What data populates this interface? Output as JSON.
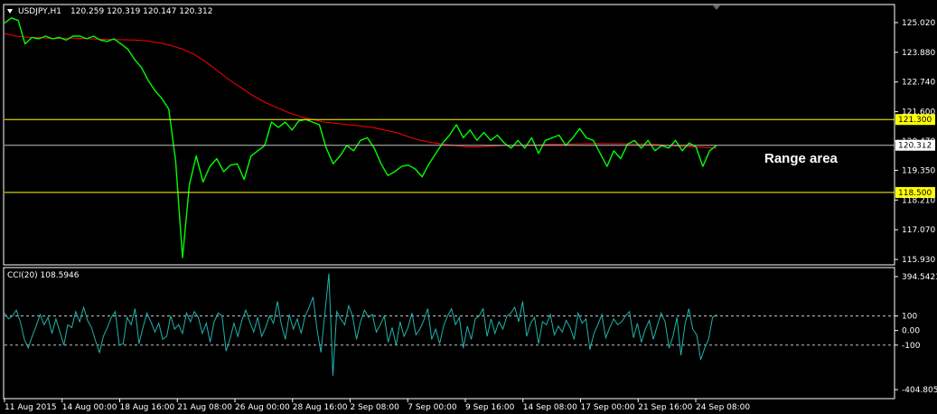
{
  "colors": {
    "background": "#000000",
    "frame": "#ffffff",
    "price": "#00ff00",
    "moving_average": "#ff0000",
    "level": "#ffff00",
    "level_tag": "#ffff00",
    "current_line": "#c0c0c0",
    "cci": "#20b2aa",
    "cci_level": "#c0c0c0"
  },
  "header": {
    "symbol": "USDJPY,H1",
    "ohlc": "120.259 120.319 120.147 120.312"
  },
  "annotation": "Range area",
  "chart_data": [
    {
      "type": "line",
      "panel": "price",
      "series": [
        {
          "values": [
            125.0,
            125.2,
            125.1,
            124.2,
            124.45,
            124.4,
            124.5,
            124.4,
            124.45,
            124.35,
            124.5,
            124.5,
            124.4,
            124.5,
            124.35,
            124.3,
            124.4,
            124.2,
            124.0,
            123.6,
            123.3,
            122.8,
            122.4,
            122.1,
            121.7,
            119.7,
            116.0,
            118.8,
            119.9,
            118.9,
            119.5,
            119.8,
            119.3,
            119.55,
            119.6,
            119.0,
            119.9,
            120.1,
            120.3,
            121.2,
            121.0,
            121.2,
            120.9,
            121.25,
            121.3,
            121.2,
            121.1,
            120.2,
            119.6,
            119.9,
            120.3,
            120.1,
            120.5,
            120.6,
            120.2,
            119.6,
            119.15,
            119.3,
            119.5,
            119.55,
            119.4,
            119.1,
            119.6,
            120.0,
            120.4,
            120.7,
            121.1,
            120.6,
            120.9,
            120.5,
            120.8,
            120.5,
            120.7,
            120.4,
            120.2,
            120.5,
            120.2,
            120.6,
            120.0,
            120.5,
            120.6,
            120.7,
            120.3,
            120.6,
            120.95,
            120.6,
            120.5,
            120.0,
            119.5,
            120.1,
            119.8,
            120.35,
            120.5,
            120.2,
            120.5,
            120.1,
            120.3,
            120.2,
            120.5,
            120.1,
            120.4,
            120.25,
            119.5,
            120.1,
            120.31
          ]
        },
        {
          "values": [
            124.6,
            124.5,
            124.45,
            124.45,
            124.4,
            124.42,
            124.42,
            124.4,
            124.38,
            124.37,
            124.36,
            124.35,
            124.32,
            124.25,
            124.15,
            124.0,
            123.8,
            123.5,
            123.15,
            122.8,
            122.5,
            122.2,
            121.95,
            121.75,
            121.55,
            121.4,
            121.3,
            121.2,
            121.15,
            121.1,
            121.05,
            121.0,
            120.9,
            120.8,
            120.65,
            120.5,
            120.42,
            120.35,
            120.3,
            120.25,
            120.25,
            120.28,
            120.3,
            120.3,
            120.32,
            120.33,
            120.35,
            120.35,
            120.36,
            120.37,
            120.38,
            120.37,
            120.37,
            120.36,
            120.36,
            120.34,
            120.3,
            120.27,
            120.25,
            120.23,
            120.2
          ]
        }
      ],
      "ylim": [
        115.93,
        125.02
      ],
      "y_ticks": [
        "125.020",
        "123.880",
        "122.740",
        "121.600",
        "120.470",
        "119.350",
        "118.210",
        "117.070",
        "115.930"
      ],
      "levels": [
        {
          "value": 121.3,
          "label": "121.300"
        },
        {
          "value": 118.5,
          "label": "118.500"
        }
      ],
      "current": {
        "value": 120.312,
        "label": "120.312"
      }
    },
    {
      "type": "line",
      "panel": "indicator",
      "title": "CCI(20) 108.5946",
      "series": [
        {
          "values": [
            120,
            80,
            100,
            140,
            60,
            -60,
            -120,
            -40,
            30,
            110,
            40,
            90,
            -20,
            80,
            -10,
            -100,
            40,
            20,
            130,
            60,
            160,
            70,
            20,
            -70,
            -150,
            -40,
            20,
            90,
            130,
            -100,
            -90,
            90,
            40,
            150,
            -90,
            20,
            120,
            60,
            -10,
            50,
            -60,
            -40,
            100,
            10,
            40,
            -20,
            120,
            60,
            130,
            90,
            -20,
            50,
            -80,
            60,
            120,
            100,
            -140,
            -60,
            50,
            -40,
            70,
            140,
            60,
            -10,
            90,
            -40,
            20,
            100,
            50,
            200,
            40,
            -60,
            110,
            10,
            80,
            -20,
            100,
            160,
            230,
            10,
            -150,
            120,
            390,
            -310,
            130,
            80,
            40,
            170,
            100,
            -60,
            60,
            140,
            90,
            110,
            -10,
            40,
            100,
            -80,
            20,
            -100,
            60,
            -40,
            20,
            120,
            -30,
            10,
            70,
            150,
            -60,
            10,
            -90,
            30,
            100,
            150,
            40,
            90,
            -120,
            30,
            -60,
            80,
            100,
            150,
            -40,
            80,
            -20,
            60,
            10,
            100,
            120,
            160,
            60,
            200,
            -40,
            50,
            90,
            -90,
            60,
            40,
            110,
            -30,
            30,
            -10,
            70,
            20,
            -60,
            120,
            50,
            80,
            -130,
            -20,
            40,
            110,
            -50,
            20,
            80,
            40,
            60,
            100,
            130,
            -50,
            50,
            -80,
            10,
            70,
            -60,
            30,
            120,
            60,
            -120,
            -40,
            90,
            -170,
            40,
            150,
            10,
            -30,
            -200,
            -120,
            -60,
            90,
            109
          ]
        }
      ],
      "ylim": [
        -404.805,
        394.5423
      ],
      "y_ticks": [
        "394.5423",
        "100",
        "0.00",
        "-100",
        "-404.805"
      ],
      "levels": [
        100,
        -100
      ],
      "x_ticks": [
        "11 Aug 2015",
        "14 Aug 00:00",
        "18 Aug 16:00",
        "21 Aug 08:00",
        "26 Aug 00:00",
        "28 Aug 16:00",
        "2 Sep 08:00",
        "7 Sep 00:00",
        "9 Sep 16:00",
        "14 Sep 08:00",
        "17 Sep 00:00",
        "21 Sep 16:00",
        "24 Sep 08:00"
      ]
    }
  ]
}
